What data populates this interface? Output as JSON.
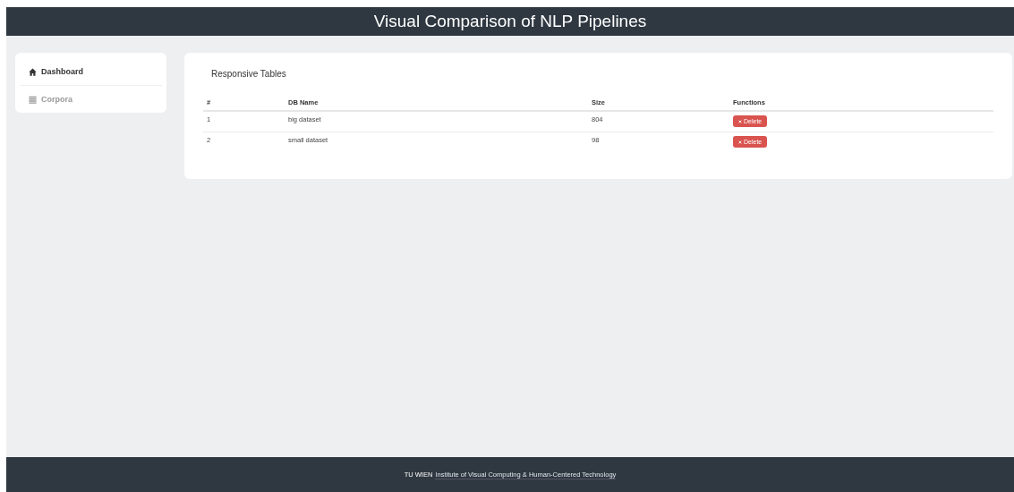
{
  "header": {
    "title": "Visual Comparison of NLP Pipelines"
  },
  "sidebar": {
    "items": [
      {
        "label": "Dashboard",
        "kind": "home",
        "selected": true
      },
      {
        "label": "Corpora",
        "kind": "list",
        "selected": false
      }
    ]
  },
  "card": {
    "title": "Responsive Tables",
    "table": {
      "columns": [
        "#",
        "DB Name",
        "Size",
        "Functions"
      ],
      "rows": [
        {
          "index": "1",
          "name": "big dataset",
          "size": "804",
          "action": "Delete"
        },
        {
          "index": "2",
          "name": "small dataset",
          "size": "98",
          "action": "Delete"
        }
      ]
    }
  },
  "footer": {
    "brand": "TU WIEN",
    "link": "Institute of Visual Computing & Human-Centered Technology"
  }
}
